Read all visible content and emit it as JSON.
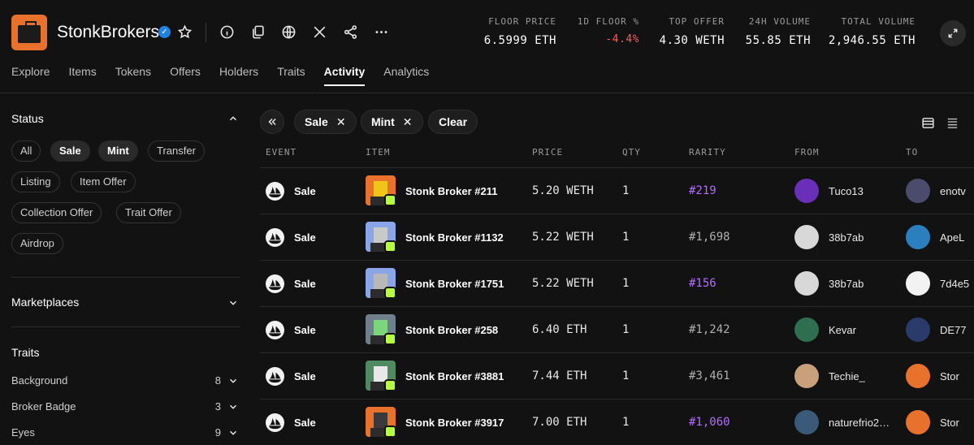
{
  "collection": {
    "name": "StonkBrokers"
  },
  "stats": [
    {
      "label": "FLOOR PRICE",
      "value": "6.5999 ETH"
    },
    {
      "label": "1D FLOOR %",
      "value": "-4.4%"
    },
    {
      "label": "TOP OFFER",
      "value": "4.30 WETH"
    },
    {
      "label": "24H VOLUME",
      "value": "55.85 ETH"
    },
    {
      "label": "TOTAL VOLUME",
      "value": "2,946.55 ETH"
    }
  ],
  "tabs": [
    "Explore",
    "Items",
    "Tokens",
    "Offers",
    "Holders",
    "Traits",
    "Activity",
    "Analytics"
  ],
  "active_tab": "Activity",
  "sidebar": {
    "status_title": "Status",
    "status_chips": [
      "All",
      "Sale",
      "Mint",
      "Transfer",
      "Listing",
      "Item Offer",
      "Collection Offer",
      "Trait Offer",
      "Airdrop"
    ],
    "marketplaces_title": "Marketplaces",
    "traits_title": "Traits",
    "traits": [
      {
        "name": "Background",
        "count": "8"
      },
      {
        "name": "Broker Badge",
        "count": "3"
      },
      {
        "name": "Eyes",
        "count": "9"
      }
    ]
  },
  "filters": {
    "sale": "Sale",
    "mint": "Mint",
    "clear": "Clear",
    "remove_glyph": "✕"
  },
  "columns": [
    "EVENT",
    "ITEM",
    "PRICE",
    "QTY",
    "RARITY",
    "FROM",
    "TO"
  ],
  "rows": [
    {
      "event": "Sale",
      "item": "Stonk Broker #211",
      "price": "5.20 WETH",
      "qty": "1",
      "rarity": "#219",
      "rarity_hl": true,
      "from": "Tuco13",
      "to": "enotv",
      "thumb_bg": "#e8712c",
      "face": "#f0c419",
      "from_av": "#6a2fb8",
      "to_av": "#4b4b6e"
    },
    {
      "event": "Sale",
      "item": "Stonk Broker #1132",
      "price": "5.22 WETH",
      "qty": "1",
      "rarity": "#1,698",
      "rarity_hl": false,
      "from": "38b7ab",
      "to": "ApeL",
      "thumb_bg": "#8aa6e8",
      "face": "#c9c9c9",
      "from_av": "#d8d8d8",
      "to_av": "#2a7fbf"
    },
    {
      "event": "Sale",
      "item": "Stonk Broker #1751",
      "price": "5.22 WETH",
      "qty": "1",
      "rarity": "#156",
      "rarity_hl": true,
      "from": "38b7ab",
      "to": "7d4e5",
      "thumb_bg": "#8aa6e8",
      "face": "#b8b8b8",
      "from_av": "#d8d8d8",
      "to_av": "#f2f2f2"
    },
    {
      "event": "Sale",
      "item": "Stonk Broker #258",
      "price": "6.40 ETH",
      "qty": "1",
      "rarity": "#1,242",
      "rarity_hl": false,
      "from": "Kevar",
      "to": "DE77",
      "thumb_bg": "#6f7f8c",
      "face": "#7cd67c",
      "from_av": "#2f6f4f",
      "to_av": "#2a3a6a"
    },
    {
      "event": "Sale",
      "item": "Stonk Broker #3881",
      "price": "7.44 ETH",
      "qty": "1",
      "rarity": "#3,461",
      "rarity_hl": false,
      "from": "Techie_",
      "to": "Stor",
      "thumb_bg": "#4f8a63",
      "face": "#e8e8e8",
      "from_av": "#c8a07a",
      "to_av": "#e8712c"
    },
    {
      "event": "Sale",
      "item": "Stonk Broker #3917",
      "price": "7.00 ETH",
      "qty": "1",
      "rarity": "#1,060",
      "rarity_hl": true,
      "from": "naturefrio2…",
      "to": "Stor",
      "thumb_bg": "#e8712c",
      "face": "#3a3a3a",
      "from_av": "#3a5a7a",
      "to_av": "#e8712c"
    }
  ],
  "colors": {
    "accent_negative": "#ff5b5b",
    "rarity_highlight": "#b46cff",
    "badge": "#b6ff3b",
    "logo": "#e8712c"
  },
  "icons": [
    "verified-badge-icon",
    "star-icon",
    "info-icon",
    "copy-icon",
    "globe-icon",
    "x-icon",
    "share-icon",
    "more-icon",
    "expand-icon",
    "collapse-sidebar-icon",
    "list-view-icon",
    "table-view-icon",
    "chevron-up-icon",
    "chevron-down-icon",
    "opensea-event-icon"
  ]
}
